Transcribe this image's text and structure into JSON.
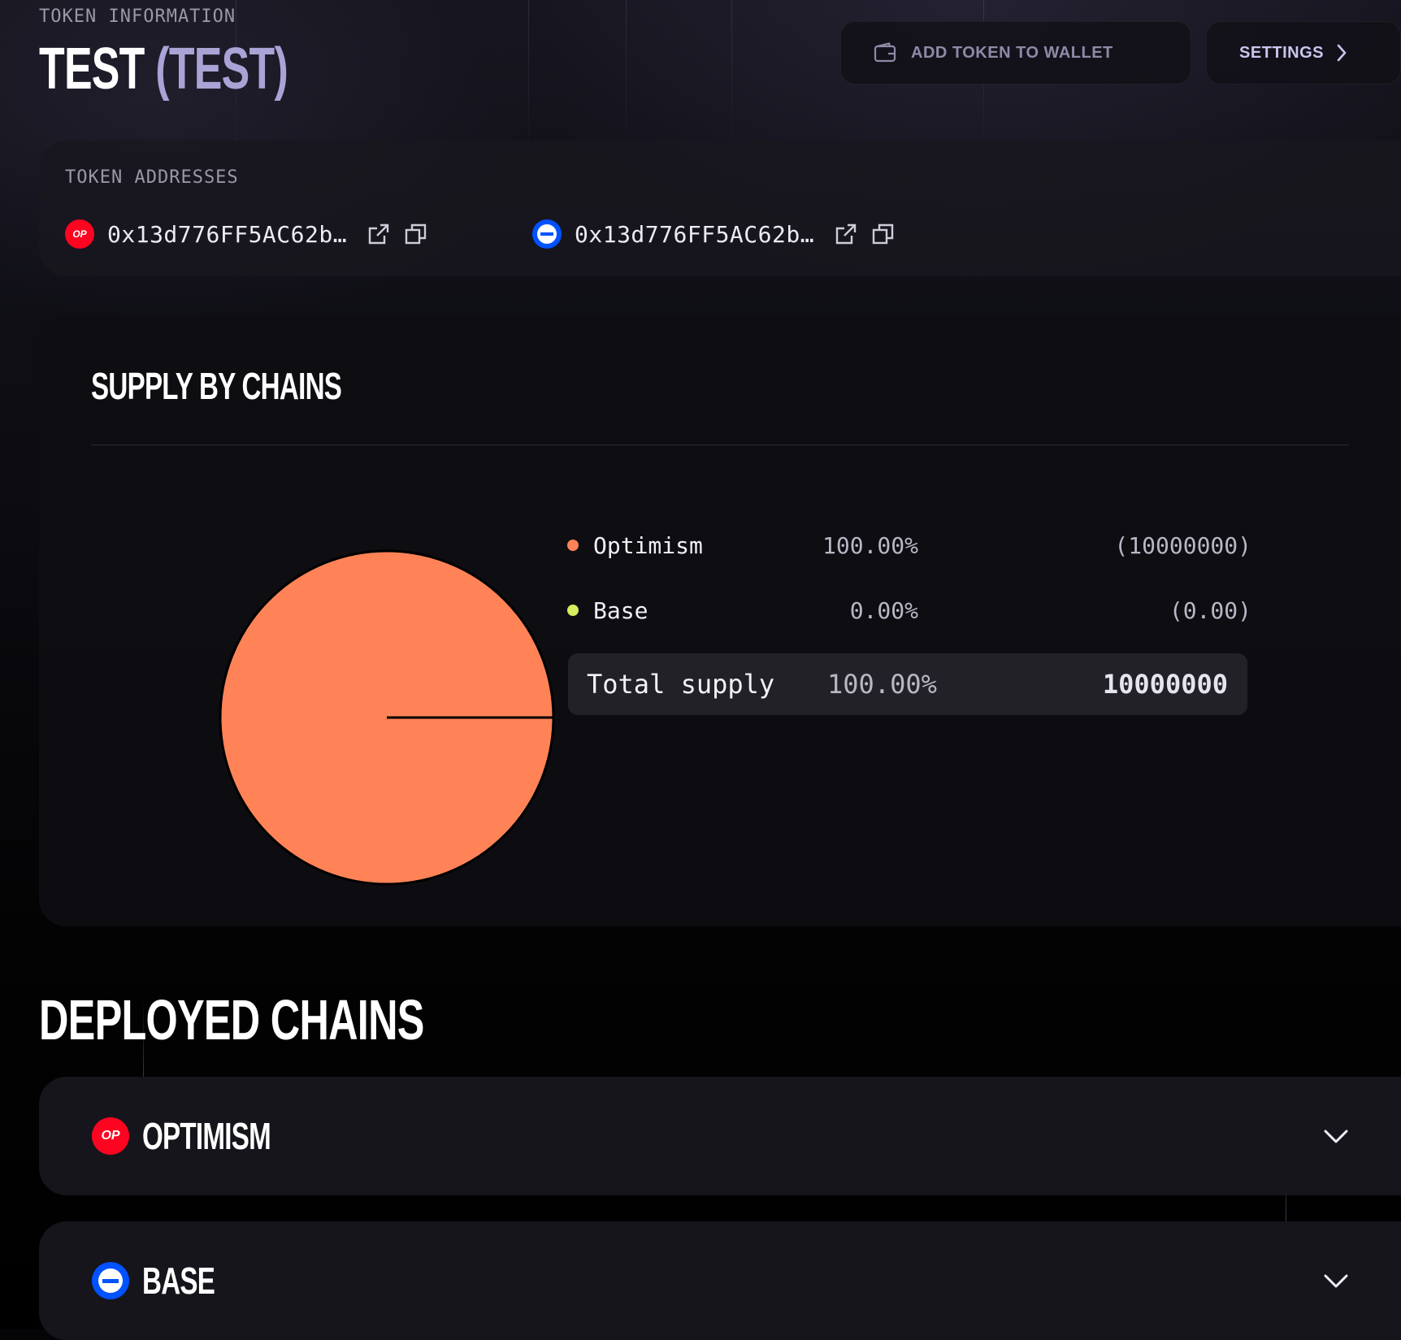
{
  "header": {
    "eyebrow": "TOKEN INFORMATION",
    "token_name": "TEST",
    "token_symbol": "(TEST)"
  },
  "actions": {
    "add_wallet_label": "ADD TOKEN TO WALLET",
    "settings_label": "SETTINGS"
  },
  "addresses": {
    "label": "TOKEN ADDRESSES",
    "items": [
      {
        "chain": "Optimism",
        "badge": "OP",
        "address": "0x13d776FF5AC62b…"
      },
      {
        "chain": "Base",
        "badge": "",
        "address": "0x13d776FF5AC62b…"
      }
    ]
  },
  "supply": {
    "title": "SUPPLY BY CHAINS",
    "total_label": "Total supply",
    "total_pct": "100.00%",
    "total_amount": "10000000"
  },
  "chart_data": {
    "type": "pie",
    "labels": [
      "Optimism",
      "Base"
    ],
    "values": [
      10000000,
      0
    ],
    "percent_labels": [
      "100.00%",
      "0.00%"
    ],
    "amount_labels": [
      "(10000000)",
      "(0.00)"
    ],
    "colors": [
      "#ff8356",
      "#d7ec5f"
    ]
  },
  "deployed": {
    "title": "DEPLOYED CHAINS",
    "chains": [
      {
        "name": "OPTIMISM",
        "badge": "OP"
      },
      {
        "name": "BASE",
        "badge": ""
      }
    ]
  },
  "icons": {
    "wallet": "wallet-icon",
    "settings_arrow": "chevron-right-icon",
    "external": "external-link-icon",
    "copy": "copy-icon",
    "expand": "chevron-down-icon"
  }
}
